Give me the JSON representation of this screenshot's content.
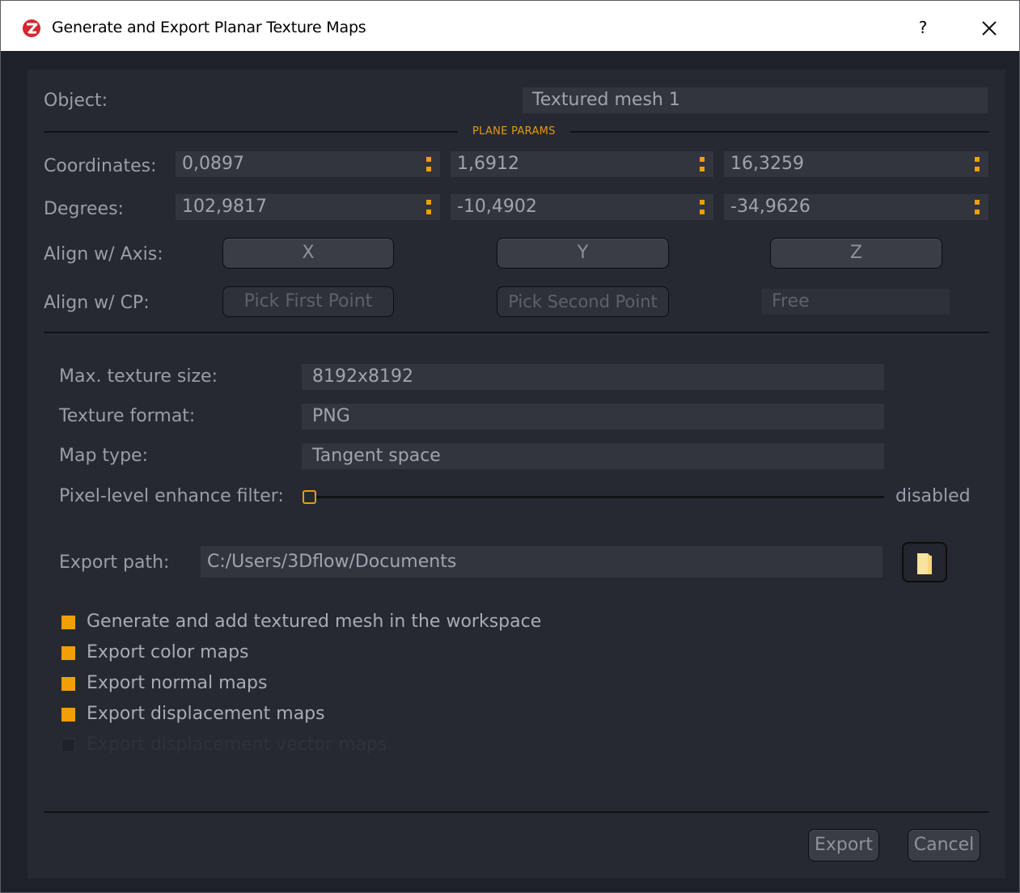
{
  "window": {
    "title": "Generate and Export Planar Texture Maps",
    "help_label": "?",
    "icons": {
      "app": "3dflow-logo-icon",
      "close": "close-icon"
    },
    "accent_color": "#f29e07"
  },
  "object": {
    "label": "Object:",
    "value": "Textured mesh 1"
  },
  "plane_params": {
    "section_title": "PLANE PARAMS",
    "coordinates": {
      "label": "Coordinates:",
      "values": [
        "0,0897",
        "1,6912",
        "16,3259"
      ]
    },
    "degrees": {
      "label": "Degrees:",
      "values": [
        "102,9817",
        "-10,4902",
        "-34,9626"
      ]
    },
    "align_axis": {
      "label": "Align w/ Axis:",
      "buttons": [
        "X",
        "Y",
        "Z"
      ]
    },
    "align_cp": {
      "label": "Align w/ CP:",
      "buttons": [
        "Pick First Point",
        "Pick Second Point"
      ],
      "mode": "Free"
    }
  },
  "texture": {
    "max_size": {
      "label": "Max. texture size:",
      "value": "8192x8192"
    },
    "format": {
      "label": "Texture format:",
      "value": "PNG"
    },
    "map_type": {
      "label": "Map type:",
      "value": "Tangent space"
    },
    "enhance_filter": {
      "label": "Pixel-level enhance filter:",
      "value": 0,
      "status": "disabled"
    }
  },
  "export": {
    "path_label": "Export path:",
    "path_value": "C:/Users/3Dflow/Documents",
    "folder_icon": "folder-icon"
  },
  "options": [
    {
      "label": "Generate and add textured mesh in the workspace",
      "checked": true,
      "enabled": true
    },
    {
      "label": "Export color maps",
      "checked": true,
      "enabled": true
    },
    {
      "label": "Export normal maps",
      "checked": true,
      "enabled": true
    },
    {
      "label": "Export displacement maps",
      "checked": true,
      "enabled": true
    },
    {
      "label": "Export displacement vector maps",
      "checked": false,
      "enabled": false
    }
  ],
  "footer": {
    "export_label": "Export",
    "cancel_label": "Cancel"
  }
}
